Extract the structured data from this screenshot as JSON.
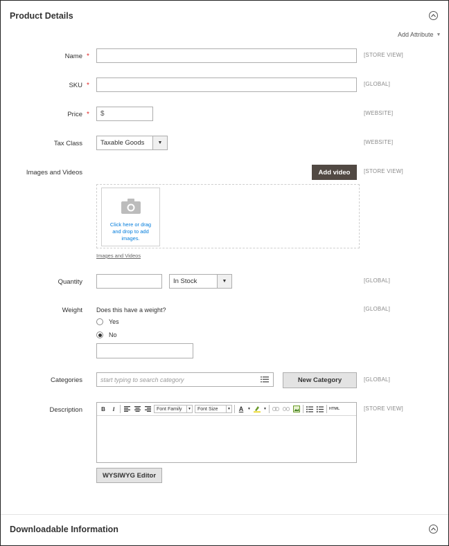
{
  "section": {
    "title": "Product Details",
    "add_attribute": "Add Attribute"
  },
  "fields": {
    "name": {
      "label": "Name",
      "required": "*",
      "scope": "[STORE VIEW]",
      "value": ""
    },
    "sku": {
      "label": "SKU",
      "required": "*",
      "scope": "[GLOBAL]",
      "value": ""
    },
    "price": {
      "label": "Price",
      "required": "*",
      "scope": "[WEBSITE]",
      "currency": "$"
    },
    "tax_class": {
      "label": "Tax Class",
      "selected": "Taxable Goods",
      "scope": "[WEBSITE]"
    },
    "images": {
      "label": "Images and Videos",
      "add_video": "Add video",
      "scope": "[STORE VIEW]",
      "upload_text": "Click here or drag and drop to add images.",
      "caption": "Images and Videos"
    },
    "quantity": {
      "label": "Quantity",
      "value": "",
      "stock_status": "In Stock",
      "scope": "[GLOBAL]"
    },
    "weight": {
      "label": "Weight",
      "question": "Does this have a weight?",
      "options": [
        "Yes",
        "No"
      ],
      "selected": "No",
      "scope": "[GLOBAL]"
    },
    "categories": {
      "label": "Categories",
      "placeholder": "start typing to search category",
      "new_category": "New Category",
      "scope": "[GLOBAL]"
    },
    "description": {
      "label": "Description",
      "scope": "[STORE VIEW]",
      "toolbar": {
        "bold": "B",
        "italic": "I",
        "font_family": "Font Family",
        "font_size": "Font Size",
        "text_color": "A",
        "html": "HTML"
      },
      "wysiwyg_button": "WYSIWYG Editor"
    }
  },
  "next_section": {
    "title": "Downloadable Information"
  }
}
